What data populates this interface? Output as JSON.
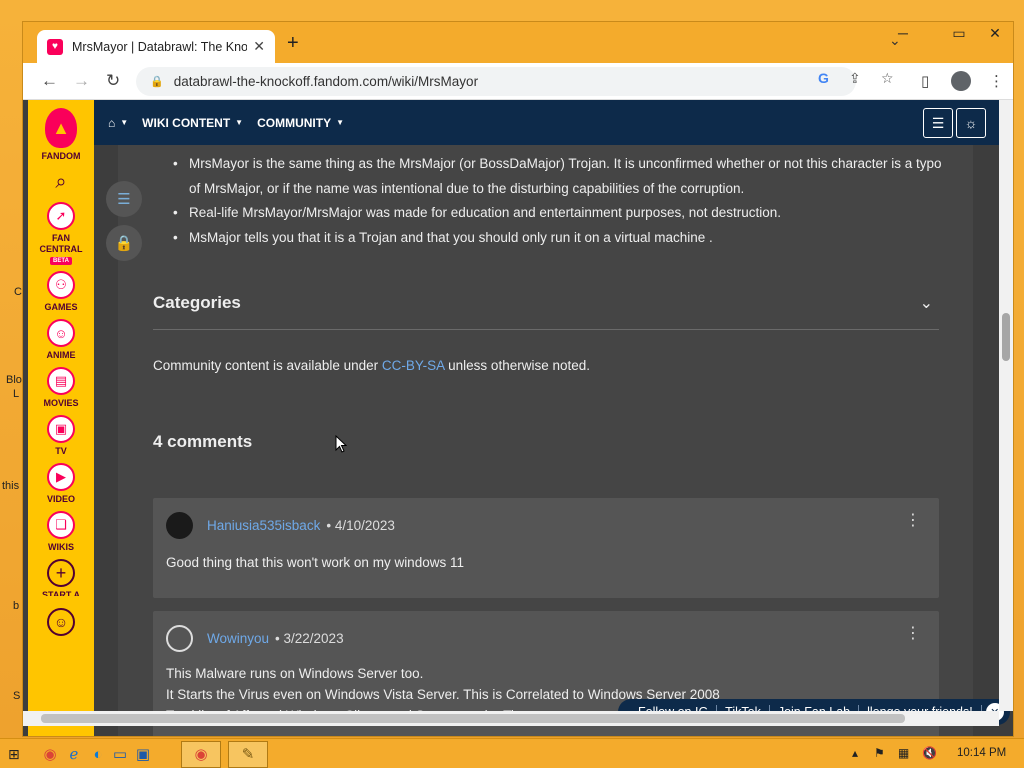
{
  "browser": {
    "tab_title": "MrsMayor | Databrawl: The Knockoff",
    "tab_close": "✕",
    "new_tab": "+",
    "url": "databrawl-the-knockoff.fandom.com/wiki/MrsMayor"
  },
  "rail": {
    "logo_label": "FANDOM",
    "items": [
      {
        "label": "FAN\nCENTRAL",
        "badge": "BETA",
        "icon": "rocket-icon"
      },
      {
        "label": "GAMES",
        "icon": "gamepad-icon"
      },
      {
        "label": "ANIME",
        "icon": "anime-face-icon"
      },
      {
        "label": "MOVIES",
        "icon": "film-icon"
      },
      {
        "label": "TV",
        "icon": "tv-icon"
      },
      {
        "label": "VIDEO",
        "icon": "play-icon"
      },
      {
        "label": "WIKIS",
        "icon": "book-icon"
      },
      {
        "label": "START A",
        "icon": "plus-icon"
      }
    ]
  },
  "topnav": {
    "wiki_content": "WIKI CONTENT",
    "community": "COMMUNITY"
  },
  "article": {
    "bullets": [
      "MrsMayor is the same thing as the MrsMajor (or BossDaMajor) Trojan. It is unconfirmed whether or not this character is a typo of MrsMajor, or if the name was intentional due to the disturbing capabilities of the corruption.",
      "Real-life MrsMayor/MrsMajor was made for education and entertainment purposes, not destruction.",
      "MsMajor tells you that it is a Trojan and that you should only run it on a virtual machine ."
    ],
    "categories_title": "Categories",
    "license_prefix": "Community content is available under ",
    "license_link": "CC-BY-SA",
    "license_suffix": " unless otherwise noted."
  },
  "comments": {
    "title": "4 comments",
    "items": [
      {
        "user": "Haniusia535isback",
        "date": "4/10/2023",
        "lines": [
          "Good thing that this won't work on my windows 11"
        ]
      },
      {
        "user": "Wowinyou",
        "date": "3/22/2023",
        "lines": [
          "This Malware runs on Windows Server too.",
          "It Starts the Virus even on Windows Vista Server. This is Correlated to Windows Server 2008",
          "Total list of Affected Windows Clients and Servers at the Time:"
        ]
      }
    ]
  },
  "promo_chips": [
    "Follow on IG",
    "TikTok",
    "Join Fan Lab",
    "llenge your friends!"
  ],
  "taskbar": {
    "clock": "10:14 PM"
  },
  "desktop_fragments": [
    "Blo",
    "L",
    "this",
    "b",
    "S",
    "C"
  ],
  "colors": {
    "fandom_pink": "#fa005a",
    "fandom_yellow": "#ffc500",
    "nav_blue": "#0d2a4a",
    "link_blue": "#6fa9e8"
  }
}
